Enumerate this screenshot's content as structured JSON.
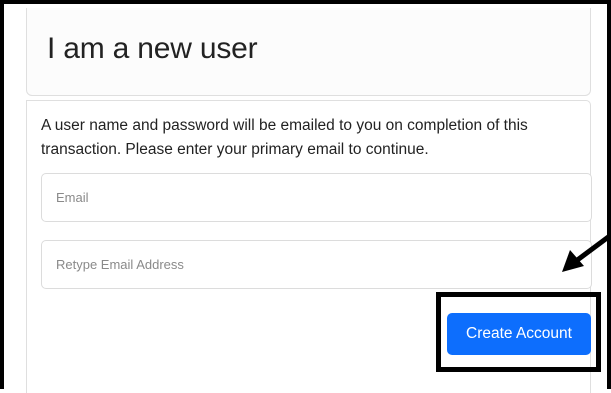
{
  "header": {
    "title": "I am a new user"
  },
  "body": {
    "instructions": "A user name and password will be emailed to you on completion of this transaction. Please enter your primary email to continue."
  },
  "form": {
    "email": {
      "placeholder": "Email",
      "value": ""
    },
    "retype_email": {
      "placeholder": "Retype Email Address",
      "value": ""
    },
    "submit_label": "Create Account"
  },
  "colors": {
    "button": "#0d6efd",
    "button_text": "#ffffff",
    "annotation": "#000000"
  },
  "icons": {
    "annotation_arrow": "arrow-down-left-icon"
  }
}
